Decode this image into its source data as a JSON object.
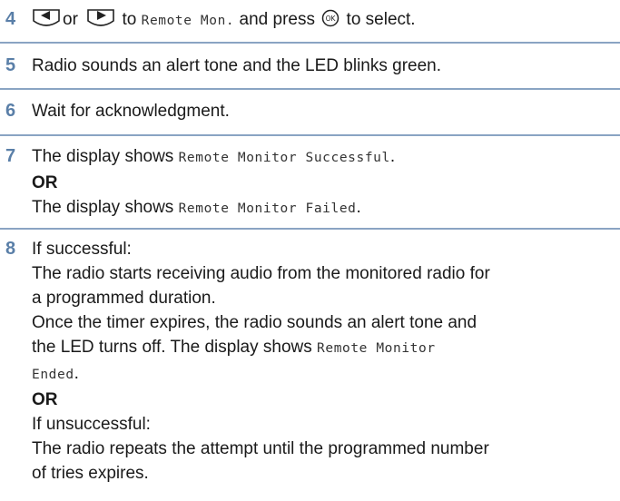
{
  "steps": [
    {
      "number": "4",
      "line": {
        "or_word": "or",
        "to_word": "to",
        "menu_item": "Remote Mon.",
        "press_text": "and press",
        "select_text": "to select."
      },
      "icons": [
        "left-arrow-key-icon",
        "right-arrow-key-icon",
        "ok-key-icon"
      ]
    },
    {
      "number": "5",
      "text": "Radio sounds an alert tone and the LED blinks green."
    },
    {
      "number": "6",
      "text": "Wait for acknowledgment."
    },
    {
      "number": "7",
      "line1_prefix": "The display shows",
      "line1_mono": "Remote Monitor Successful",
      "line1_suffix": ".",
      "or_label": "OR",
      "line2_prefix": "The display shows",
      "line2_mono": "Remote Monitor Failed",
      "line2_suffix": "."
    },
    {
      "number": "8",
      "if_success": "If successful:",
      "success_p1_l1": "The radio starts receiving audio from the monitored radio for",
      "success_p1_l2": "a programmed duration.",
      "success_p2_l1": "Once the timer expires, the radio sounds an alert tone and",
      "success_p2_l2_prefix": "the LED turns off. The display shows",
      "success_p2_l2_mono": "Remote Monitor",
      "success_p2_l3_mono": "Ended",
      "success_p2_l3_suffix": ".",
      "or_label": "OR",
      "if_fail": "If unsuccessful:",
      "fail_l1": "The radio repeats the attempt until the programmed number",
      "fail_l2": "of tries expires."
    }
  ],
  "colors": {
    "step_number": "#5a7fa8",
    "rule": "#8aa4c3",
    "text": "#1a1a1a"
  }
}
